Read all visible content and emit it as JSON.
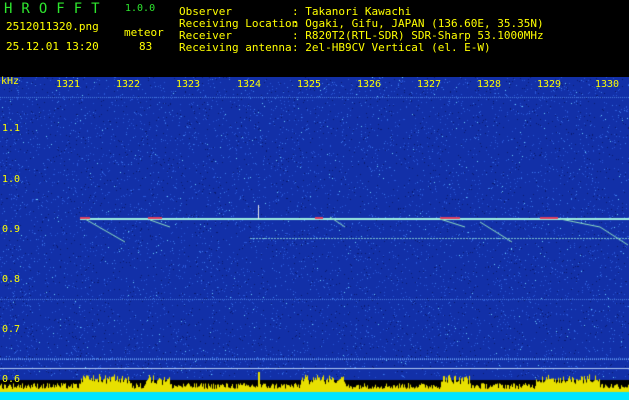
{
  "app": {
    "logo": "HROFFT",
    "version": "1.0.0",
    "filename": "2512011320.png",
    "timestamp": "25.12.01 13:20",
    "meteor_label": "meteor",
    "meteor_count": "83"
  },
  "info": [
    {
      "label": "Observer",
      "value": ": Takanori Kawachi"
    },
    {
      "label": "Receiving Location",
      "value": ": Ogaki, Gifu, JAPAN (136.60E, 35.35N)"
    },
    {
      "label": "Receiver",
      "value": ": R820T2(RTL-SDR) SDR-Sharp 53.1000MHz"
    },
    {
      "label": "Receiving antenna",
      "value": ": 2el-HB9CV Vertical (el. E-W)"
    }
  ],
  "spectrogram": {
    "y_unit": "kHz",
    "y_ticks": [
      "1.1",
      "1.0",
      "0.9",
      "0.8",
      "0.7",
      "0.6"
    ],
    "x_ticks": [
      "1321",
      "1322",
      "1323",
      "1324",
      "1325",
      "1326",
      "1327",
      "1328",
      "1329",
      "1330"
    ],
    "colors": {
      "background": "#1230a8",
      "carrier": "#9ff0e0",
      "label": "#ffff00",
      "activity": "#e8e000",
      "activity_base": "#00e5ff"
    }
  }
}
